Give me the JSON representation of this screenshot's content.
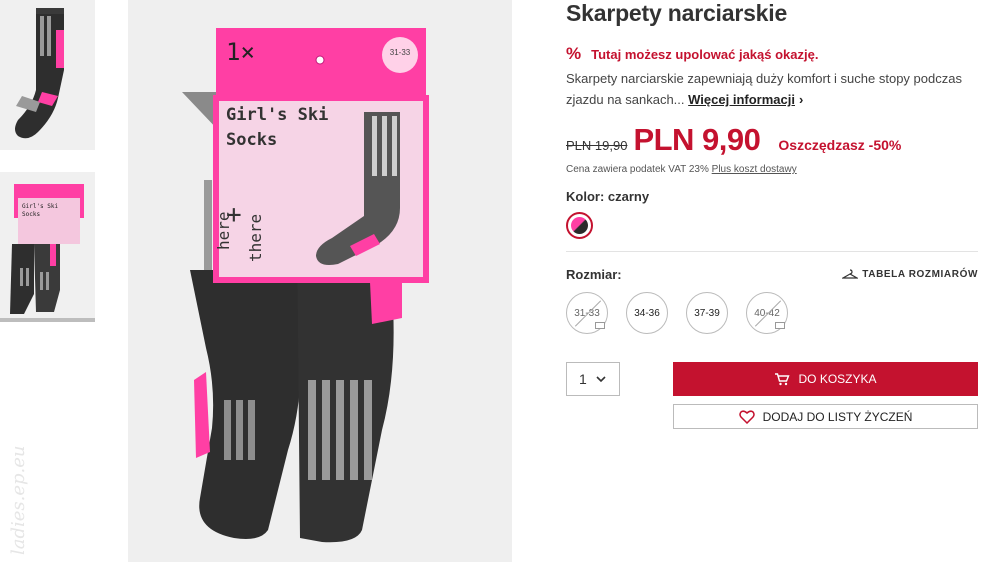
{
  "product": {
    "title": "Skarpety narciarskie",
    "promo_icon": "%",
    "promo_text": "Tutaj możesz upolować jakąś okazję.",
    "description": "Skarpety narciarskie zapewniają duży komfort i suche stopy podczas zjazdu na sankach...",
    "more_link": "Więcej informacji",
    "old_price": "PLN 19,90",
    "new_price": "PLN 9,90",
    "savings": "Oszczędzasz -50%",
    "vat_text": "Cena zawiera podatek VAT 23%",
    "shipping_link": "Plus koszt dostawy",
    "color_label": "Kolor: czarny",
    "size_label": "Rozmiar:",
    "size_chart": "TABELA ROZMIARÓW",
    "sizes": [
      {
        "label": "31-33",
        "available": false
      },
      {
        "label": "34-36",
        "available": true
      },
      {
        "label": "37-39",
        "available": true
      },
      {
        "label": "40-42",
        "available": false
      }
    ],
    "quantity": "1",
    "add_to_cart": "DO KOSZYKA",
    "wishlist": "DODAJ DO LISTY ŻYCZEŃ"
  },
  "packaging": {
    "count": "1×",
    "size": "31-33",
    "name_line1": "Girl's Ski",
    "name_line2": "Socks",
    "here": "here",
    "plus": "+",
    "there": "there"
  },
  "watermark": "ladies.ep.eu",
  "icons": [
    "percent-icon",
    "chevron-right-icon",
    "hanger-icon",
    "mail-icon",
    "chevron-down-icon",
    "cart-icon",
    "heart-icon"
  ],
  "colors": {
    "accent": "#c4122f",
    "pink": "#ff3fa4",
    "sock_dark": "#2e2e2e",
    "sock_grey": "#9a9a9a"
  }
}
